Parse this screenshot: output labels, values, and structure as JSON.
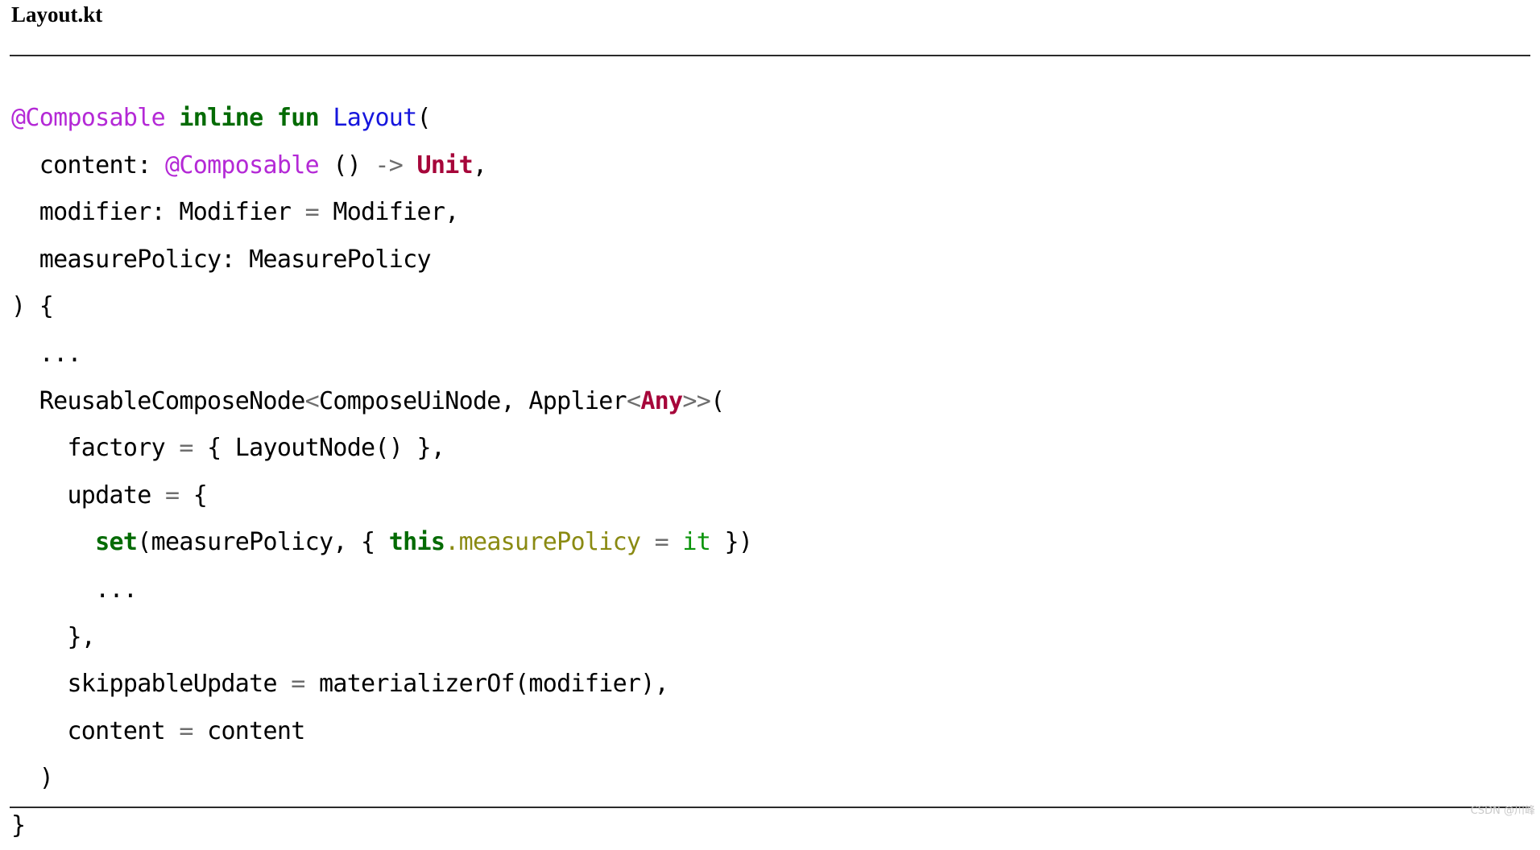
{
  "document": {
    "file_title": "Layout.kt",
    "watermark": "CSDN @川峰"
  },
  "colors": {
    "background": "#ffffff",
    "text": "#000000",
    "rule": "#2b2b2b",
    "annotation": "#b429d6",
    "keyword": "#046b04",
    "function": "#1616dd",
    "type": "#a6063a",
    "operator": "#6e6e6e",
    "property": "#8a8a12",
    "variable": "#0c950c",
    "watermark": "#c9c9c9"
  },
  "code": {
    "language": "kotlin",
    "lines": [
      {
        "n": 1,
        "indent": 0,
        "text": "@Composable inline fun Layout(",
        "tokens": [
          {
            "t": "@Composable",
            "k": "anno"
          },
          {
            "t": " ",
            "k": "plain"
          },
          {
            "t": "inline fun",
            "k": "kw"
          },
          {
            "t": " ",
            "k": "plain"
          },
          {
            "t": "Layout",
            "k": "fn"
          },
          {
            "t": "(",
            "k": "plain"
          }
        ]
      },
      {
        "n": 2,
        "indent": 2,
        "text": "  content: @Composable () -> Unit,",
        "tokens": [
          {
            "t": "  content: ",
            "k": "plain"
          },
          {
            "t": "@Composable",
            "k": "anno"
          },
          {
            "t": " () ",
            "k": "plain"
          },
          {
            "t": "->",
            "k": "op"
          },
          {
            "t": " ",
            "k": "plain"
          },
          {
            "t": "Unit",
            "k": "type"
          },
          {
            "t": ",",
            "k": "plain"
          }
        ]
      },
      {
        "n": 3,
        "indent": 2,
        "text": "  modifier: Modifier = Modifier,",
        "tokens": [
          {
            "t": "  modifier: Modifier ",
            "k": "plain"
          },
          {
            "t": "=",
            "k": "op"
          },
          {
            "t": " Modifier,",
            "k": "plain"
          }
        ]
      },
      {
        "n": 4,
        "indent": 2,
        "text": "  measurePolicy: MeasurePolicy",
        "tokens": [
          {
            "t": "  measurePolicy: MeasurePolicy",
            "k": "plain"
          }
        ]
      },
      {
        "n": 5,
        "indent": 0,
        "text": ") {",
        "tokens": [
          {
            "t": ") {",
            "k": "plain"
          }
        ]
      },
      {
        "n": 6,
        "indent": 2,
        "text": "  ...",
        "tokens": [
          {
            "t": "  ...",
            "k": "dots"
          }
        ]
      },
      {
        "n": 7,
        "indent": 2,
        "text": "  ReusableComposeNode<ComposeUiNode, Applier<Any>>(",
        "tokens": [
          {
            "t": "  ReusableComposeNode",
            "k": "plain"
          },
          {
            "t": "<",
            "k": "op"
          },
          {
            "t": "ComposeUiNode, Applier",
            "k": "plain"
          },
          {
            "t": "<",
            "k": "op"
          },
          {
            "t": "Any",
            "k": "type"
          },
          {
            "t": ">>",
            "k": "op"
          },
          {
            "t": "(",
            "k": "plain"
          }
        ]
      },
      {
        "n": 8,
        "indent": 4,
        "text": "    factory = { LayoutNode() },",
        "tokens": [
          {
            "t": "    factory ",
            "k": "plain"
          },
          {
            "t": "=",
            "k": "op"
          },
          {
            "t": " { LayoutNode() },",
            "k": "plain"
          }
        ]
      },
      {
        "n": 9,
        "indent": 4,
        "text": "    update = {",
        "tokens": [
          {
            "t": "    update ",
            "k": "plain"
          },
          {
            "t": "=",
            "k": "op"
          },
          {
            "t": " {",
            "k": "plain"
          }
        ]
      },
      {
        "n": 10,
        "indent": 6,
        "text": "      set(measurePolicy, { this.measurePolicy = it })",
        "tokens": [
          {
            "t": "      ",
            "k": "plain"
          },
          {
            "t": "set",
            "k": "kw"
          },
          {
            "t": "(measurePolicy, { ",
            "k": "plain"
          },
          {
            "t": "this",
            "k": "kw"
          },
          {
            "t": ".measurePolicy",
            "k": "prop"
          },
          {
            "t": " ",
            "k": "plain"
          },
          {
            "t": "=",
            "k": "op"
          },
          {
            "t": " ",
            "k": "plain"
          },
          {
            "t": "it",
            "k": "var"
          },
          {
            "t": " })",
            "k": "plain"
          }
        ]
      },
      {
        "n": 11,
        "indent": 6,
        "text": "      ...",
        "tokens": [
          {
            "t": "      ...",
            "k": "dots"
          }
        ]
      },
      {
        "n": 12,
        "indent": 4,
        "text": "    },",
        "tokens": [
          {
            "t": "    },",
            "k": "plain"
          }
        ]
      },
      {
        "n": 13,
        "indent": 4,
        "text": "    skippableUpdate = materializerOf(modifier),",
        "tokens": [
          {
            "t": "    skippableUpdate ",
            "k": "plain"
          },
          {
            "t": "=",
            "k": "op"
          },
          {
            "t": " materializerOf(modifier),",
            "k": "plain"
          }
        ]
      },
      {
        "n": 14,
        "indent": 4,
        "text": "    content = content",
        "tokens": [
          {
            "t": "    content ",
            "k": "plain"
          },
          {
            "t": "=",
            "k": "op"
          },
          {
            "t": " content",
            "k": "plain"
          }
        ]
      },
      {
        "n": 15,
        "indent": 2,
        "text": "  )",
        "tokens": [
          {
            "t": "  )",
            "k": "plain"
          }
        ]
      },
      {
        "n": 16,
        "indent": 0,
        "text": "}",
        "tokens": [
          {
            "t": "}",
            "k": "plain"
          }
        ]
      }
    ]
  }
}
